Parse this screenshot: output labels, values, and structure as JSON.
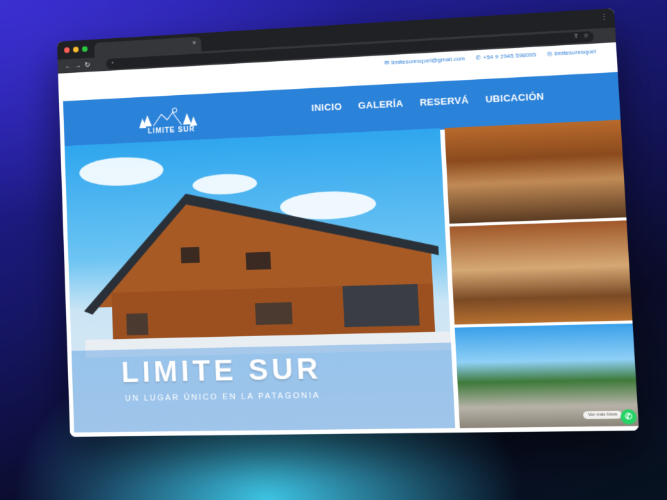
{
  "browser": {
    "tab_close": "×",
    "menu_icon": "⋮",
    "back": "←",
    "forward": "→",
    "reload": "↻",
    "lock": "🔒"
  },
  "contact": {
    "email": "limitesuresquel@gmail.com",
    "phone": "+54 9 2945 598095",
    "instagram": "limitesuresquel"
  },
  "logo": {
    "text": "LIMITE SUR"
  },
  "menu": [
    {
      "label": "INICIO"
    },
    {
      "label": "GALERÍA"
    },
    {
      "label": "RESERVÁ"
    },
    {
      "label": "UBICACIÓN"
    }
  ],
  "hero": {
    "title": "LIMITE SUR",
    "subtitle": "UN LUGAR ÚNICO EN LA PATAGONIA"
  },
  "gallery": {
    "more_label": "Ver más fotos"
  },
  "colors": {
    "brand_blue": "#2b82d9",
    "whatsapp": "#25d366"
  }
}
